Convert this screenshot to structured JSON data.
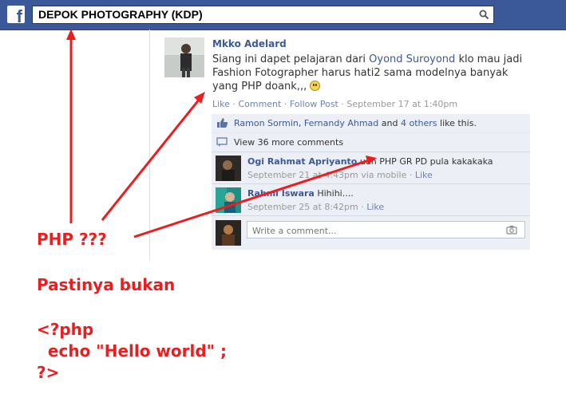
{
  "header": {
    "search_value": "DEPOK PHOTOGRAPHY (KDP)"
  },
  "post": {
    "author": "Mkko Adelard",
    "text_before": "Siang ini dapet pelajaran dari ",
    "mention": "Oyond Suroyond",
    "text_after": " klo mau jadi Fashion Fotographer harus hati2 sama modelnya banyak yang PHP doank,,,",
    "actions": {
      "like": "Like",
      "comment": "Comment",
      "follow": "Follow Post",
      "timestamp": "September 17 at 1:40pm",
      "separator": " · "
    }
  },
  "likes": {
    "name1": "Ramon Sormin",
    "comma": ", ",
    "name2": "Fernandy Ahmad",
    "and": " and ",
    "others": "4 others",
    "suffix": " like this."
  },
  "view_comments": "View 36 more comments",
  "comments": [
    {
      "name": "Ogi Rahmat Apriyanto",
      "text": " udh PHP GR PD pula kakakaka",
      "time": "September 21 at 4:43pm via mobile",
      "like": "Like"
    },
    {
      "name": "Rahmi Iswara",
      "text": " Hihihi....",
      "time": "September 25 at 8:42pm",
      "like": "Like"
    }
  ],
  "write_comment_placeholder": "Write a comment...",
  "annotations": {
    "php_question": "PHP ???",
    "line1": "Pastinya bukan",
    "line2": "<?php",
    "line3": "  echo \"Hello world\" ;",
    "line4": "?>"
  },
  "colors": {
    "facebook_blue": "#3b5998",
    "link_blue": "#3b5998",
    "annotation_red": "#ee1c1c",
    "comment_bg": "#eceff5"
  }
}
